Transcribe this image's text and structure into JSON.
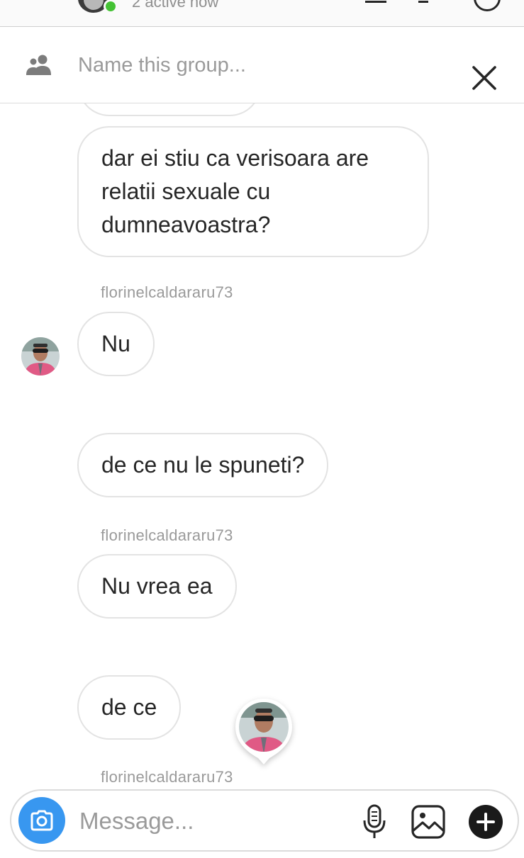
{
  "header": {
    "active_status": "2 active now"
  },
  "group": {
    "name_placeholder": "Name this group...",
    "icons": {
      "group": "group-people-icon",
      "close": "close-x-icon"
    }
  },
  "messages": [
    {
      "text": "dar ei stiu ca verisoara are relatii sexuale cu dumneavoastra?"
    },
    {
      "sender": "florinelcaldararu73",
      "text": "Nu"
    },
    {
      "text": "de ce nu le spuneti?"
    },
    {
      "sender": "florinelcaldararu73",
      "text": "Nu vrea ea"
    },
    {
      "text": "de ce"
    },
    {
      "sender": "florinelcaldararu73"
    }
  ],
  "composer": {
    "placeholder": "Message...",
    "icons": {
      "camera": "camera-icon",
      "mic": "microphone-icon",
      "gallery": "gallery-icon",
      "more": "plus-icon"
    }
  },
  "colors": {
    "accent_blue": "#3897f0",
    "online_green": "#44c234",
    "bubble_border": "#e3e3e3",
    "secondary_text": "#9a9a9a"
  }
}
